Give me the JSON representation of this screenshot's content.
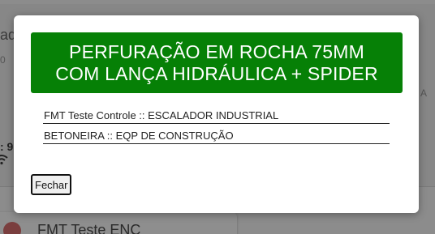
{
  "background": {
    "fragment_top": "ado",
    "fragment_sub": "0",
    "fragment_bold": ": 9",
    "fragment_right": ": A",
    "list_card_title": "FMT Teste ENC"
  },
  "modal": {
    "title_line1": "PERFURAÇÃO EM ROCHA 75MM",
    "title_line2": "COM LANÇA HIDRÁULICA + SPIDER",
    "header_color": "#068006",
    "items": [
      {
        "label": "FMT Teste Controle :: ESCALADOR INDUSTRIAL"
      },
      {
        "label": "BETONEIRA :: EQP DE CONSTRUÇÃO"
      }
    ],
    "close_label": "Fechar"
  }
}
